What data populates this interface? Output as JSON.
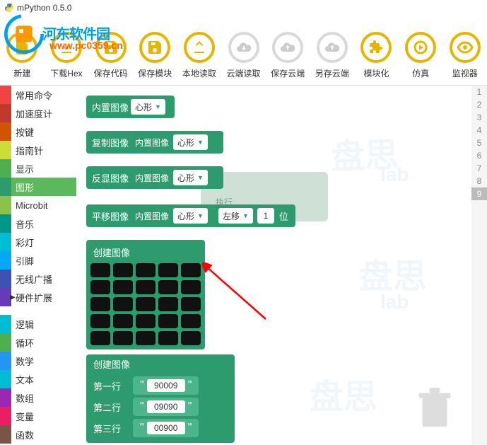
{
  "window": {
    "title": "mPython 0.5.0"
  },
  "watermark": {
    "main": "河东软件园",
    "url": "www.pc0359.cn"
  },
  "toolbar": [
    {
      "id": "new",
      "label": "新建"
    },
    {
      "id": "download",
      "label": "下载Hex"
    },
    {
      "id": "save-code",
      "label": "保存代码"
    },
    {
      "id": "save-block",
      "label": "保存模块"
    },
    {
      "id": "load-local",
      "label": "本地读取"
    },
    {
      "id": "load-cloud",
      "label": "云端读取",
      "gray": true
    },
    {
      "id": "save-cloud",
      "label": "保存云端",
      "gray": true
    },
    {
      "id": "saveas-cloud",
      "label": "另存云端",
      "gray": true
    },
    {
      "id": "modularize",
      "label": "模块化"
    },
    {
      "id": "simulate",
      "label": "仿真"
    },
    {
      "id": "monitor",
      "label": "监视器"
    }
  ],
  "sidebar": [
    {
      "label": "常用命令",
      "color": "#e44"
    },
    {
      "label": "加速度计",
      "color": "#c0392b"
    },
    {
      "label": "按键",
      "color": "#d35400"
    },
    {
      "label": "指南针",
      "color": "#cddc39"
    },
    {
      "label": "显示",
      "color": "#4caf50"
    },
    {
      "label": "图形",
      "color": "#2e9b6e",
      "selected": true
    },
    {
      "label": "Microbit",
      "color": "#8bc34a"
    },
    {
      "label": "音乐",
      "color": "#009688"
    },
    {
      "label": "彩灯",
      "color": "#00bcd4"
    },
    {
      "label": "引脚",
      "color": "#03a9f4"
    },
    {
      "label": "无线广播",
      "color": "#3f51b5"
    },
    {
      "label": "硬件扩展",
      "color": "#673ab7",
      "expandable": true
    },
    {
      "label": "逻辑",
      "color": "#00bcd4"
    },
    {
      "label": "循环",
      "color": "#4caf50"
    },
    {
      "label": "数学",
      "color": "#2196f3"
    },
    {
      "label": "文本",
      "color": "#00bcd4"
    },
    {
      "label": "数组",
      "color": "#9c27b0"
    },
    {
      "label": "变量",
      "color": "#e91e63"
    },
    {
      "label": "函数",
      "color": "#795548"
    }
  ],
  "blocks": {
    "builtin_img": {
      "label": "内置图像",
      "shape": "心形"
    },
    "copy_img": {
      "label": "复制图像",
      "inner_label": "内置图像",
      "shape": "心形"
    },
    "invert_img": {
      "label": "反显图像",
      "inner_label": "内置图像",
      "shape": "心形"
    },
    "shift_img": {
      "label": "平移图像",
      "inner_label": "内置图像",
      "shape": "心形",
      "dir": "左移",
      "num": "1",
      "unit": "位"
    },
    "create_img": {
      "label": "创建图像"
    },
    "create_img_rows": {
      "label": "创建图像",
      "rows": [
        {
          "label": "第一行",
          "value": "90009"
        },
        {
          "label": "第二行",
          "value": "09090"
        },
        {
          "label": "第三行",
          "value": "00900"
        }
      ]
    },
    "exec_hint": "执行"
  },
  "linenums": {
    "count": 9,
    "selected": 9
  }
}
